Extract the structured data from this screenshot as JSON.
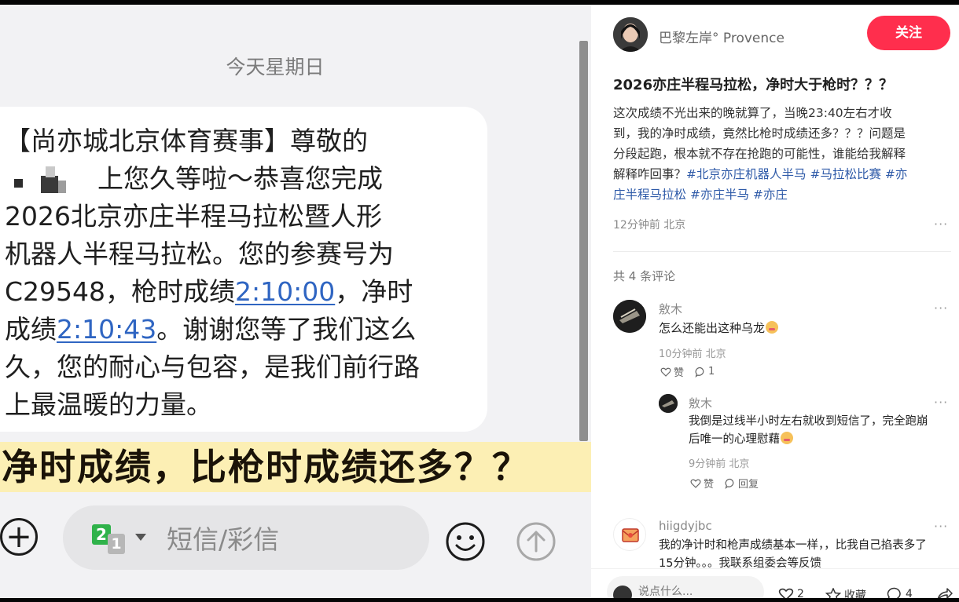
{
  "sms": {
    "date_label": "今天星期日",
    "lines": {
      "l1": "【尚亦城北京体育赛事】尊敬的",
      "l2": "上您久等啦～恭喜您完成",
      "l3": "2026北京亦庄半程马拉松暨人形",
      "l4": "机器人半程马拉松。您的参赛号为",
      "l5_pre": "C29548，枪时成绩",
      "gun_time": "2:10:00",
      "l5_post": "，净时",
      "l6_pre": "成绩",
      "net_time": "2:10:43",
      "l6_post": "。谢谢您等了我们这么",
      "l7": "久，您的耐心与包容，是我们前行路",
      "l8": "上最温暖的力量。"
    },
    "caption": "净时成绩，比枪时成绩还多？？",
    "input_placeholder": "短信/彩信",
    "sim_primary": "2",
    "sim_secondary": "1",
    "plus_symbol": "+"
  },
  "post": {
    "author": "巴黎左岸° Provence",
    "follow_label": "关注",
    "title": "2026亦庄半程马拉松，净时大于枪时？？？",
    "body": {
      "l1": "这次成绩不光出来的晚就算了，当晚23:40左右才收",
      "l2": "到，我的净时成绩，竟然比枪时成绩还多？？？问题是",
      "l3": "分段起跑，根本就不存在抢跑的可能性，谁能给我解释",
      "l4_pre": "解释咋回事？",
      "tag1": "#北京亦庄机器人半马",
      "tag2": "#马拉松比赛",
      "tag3a": "#亦",
      "tag3b": "庄半程马拉松",
      "tag4": "#亦庄半马",
      "tag5": "#亦庄"
    },
    "meta": "12分钟前 北京",
    "more": "···",
    "comment_count": "共 4 条评论"
  },
  "comments": [
    {
      "name": "敫木",
      "text": "怎么还能出这种乌龙",
      "time": "10分钟前 北京",
      "like_label": "赞",
      "reply_count": "1",
      "more": "···"
    },
    {
      "name": "敫木",
      "text_l1": "我倒是过线半小时左右就收到短信了，完全跑崩",
      "text_l2": "后唯一的心理慰藉",
      "time": "9分钟前 北京",
      "like_label": "赞",
      "reply_label": "回复",
      "more": "···"
    },
    {
      "name": "hiigdyjbc",
      "text_l1": "我的净计时和枪声成绩基本一样，，比我自己掐表多了",
      "text_l2": "15分钟。。。我联系组委会等反馈",
      "more": "···"
    }
  ],
  "bottom_bar": {
    "input_placeholder": "说点什么...",
    "like_count": "2",
    "collect_label": "收藏",
    "comment_total": "4"
  },
  "colors": {
    "follow": "#ff2e4d",
    "tag": "#2e5aa8",
    "sms_link": "#2f65c2",
    "caption_band": "#fcefb4"
  }
}
